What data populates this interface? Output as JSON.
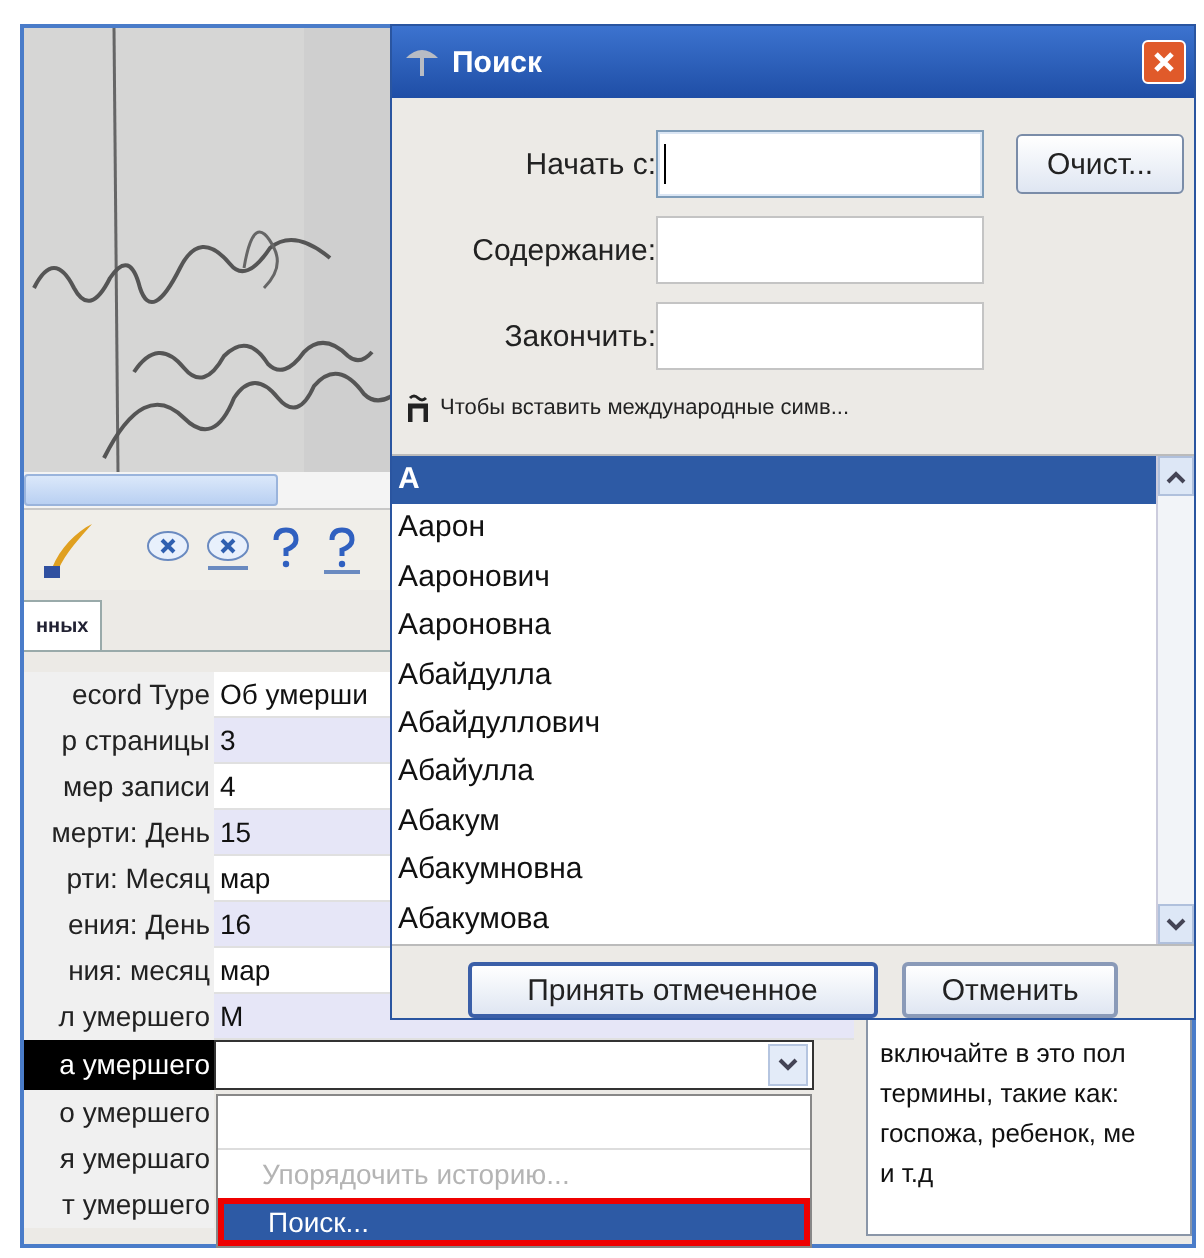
{
  "tab": {
    "label": "нных",
    "selected": true
  },
  "rows": [
    {
      "label": "ecord Type",
      "value": "Об умерши",
      "kind": "text",
      "selected": false
    },
    {
      "label": "р страницы",
      "value": "3",
      "kind": "text",
      "selected": false
    },
    {
      "label": "мер записи",
      "value": "4",
      "kind": "text",
      "selected": false
    },
    {
      "label": "мерти: День",
      "value": "15",
      "kind": "text",
      "selected": false
    },
    {
      "label": "рти: Месяц",
      "value": "мар",
      "kind": "text",
      "selected": false
    },
    {
      "label": "ения: День",
      "value": "16",
      "kind": "text",
      "selected": false
    },
    {
      "label": "ния: месяц",
      "value": "мар",
      "kind": "text",
      "selected": false
    },
    {
      "label": "л умершего",
      "value": "M",
      "kind": "text",
      "selected": false
    },
    {
      "label": "а умершего",
      "kind": "combo",
      "selected": true
    },
    {
      "label": "о умершего",
      "kind": "text",
      "selected": false
    },
    {
      "label": "я умершаго",
      "kind": "text",
      "selected": false
    },
    {
      "label": "т умершего",
      "kind": "text",
      "selected": false
    }
  ],
  "dropdown": {
    "items": [
      {
        "kind": "blank"
      },
      {
        "kind": "option",
        "label": "Упорядочить историю...",
        "disabled": true,
        "selected": false,
        "outlined": false
      },
      {
        "kind": "option",
        "label": "Поиск...",
        "disabled": false,
        "selected": true,
        "outlined": true
      }
    ]
  },
  "help": {
    "text": "включайте в это пол\nтермины, такие как:\nгоспожа, ребенок, ме\nи т.д"
  },
  "dialog": {
    "title": "Поиск",
    "fields": [
      {
        "label": "Начать с:",
        "focused": true
      },
      {
        "label": "Содержание:",
        "focused": false
      },
      {
        "label": "Закончить:",
        "focused": false
      }
    ],
    "clear_button": "Очист...",
    "hint": "Чтобы вставить международные симв...",
    "items": [
      {
        "label": "А",
        "selected": true
      },
      {
        "label": "Аарон",
        "selected": false
      },
      {
        "label": "Ааронович",
        "selected": false
      },
      {
        "label": "Аароновна",
        "selected": false
      },
      {
        "label": "Абайдулла",
        "selected": false
      },
      {
        "label": "Абайдуллович",
        "selected": false
      },
      {
        "label": "Абайулла",
        "selected": false
      },
      {
        "label": "Абакум",
        "selected": false
      },
      {
        "label": "Абакумновна",
        "selected": false
      },
      {
        "label": "Абакумова",
        "selected": false
      }
    ],
    "buttons": [
      "Принять отмеченное",
      "Отменить"
    ]
  }
}
